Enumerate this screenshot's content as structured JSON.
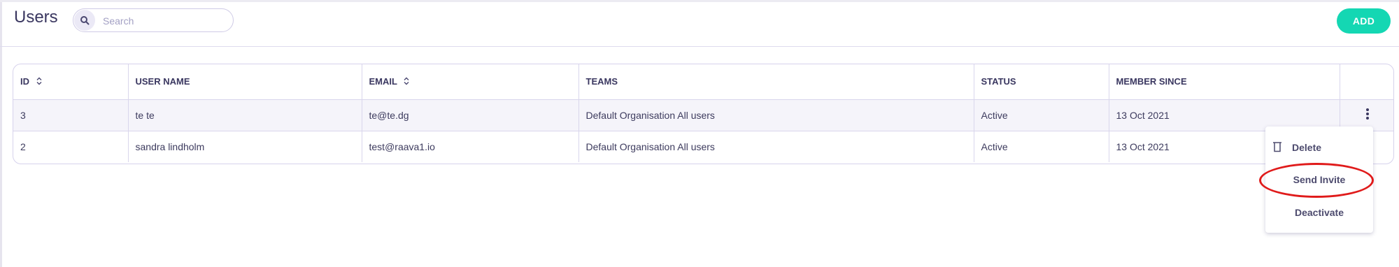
{
  "header": {
    "title": "Users",
    "search": {
      "placeholder": "Search",
      "value": ""
    },
    "add_label": "ADD"
  },
  "table": {
    "columns": {
      "id": "ID",
      "user_name": "USER NAME",
      "email": "EMAIL",
      "teams": "TEAMS",
      "status": "STATUS",
      "member_since": "MEMBER SINCE"
    },
    "rows": [
      {
        "id": "3",
        "user_name": "te te",
        "email": "te@te.dg",
        "teams": "Default Organisation All users",
        "status": "Active",
        "member_since": "13 Oct 2021"
      },
      {
        "id": "2",
        "user_name": "sandra lindholm",
        "email": "test@raava1.io",
        "teams": "Default Organisation All users",
        "status": "Active",
        "member_since": "13 Oct 2021"
      }
    ]
  },
  "menu": {
    "items": [
      {
        "label": "Delete",
        "icon": "trash-icon"
      },
      {
        "label": "Send Invite"
      },
      {
        "label": "Deactivate"
      }
    ]
  },
  "colors": {
    "accent": "#14d7b3",
    "text": "#3a3760",
    "border": "#d6d2ec",
    "highlight": "#e01b1b"
  }
}
